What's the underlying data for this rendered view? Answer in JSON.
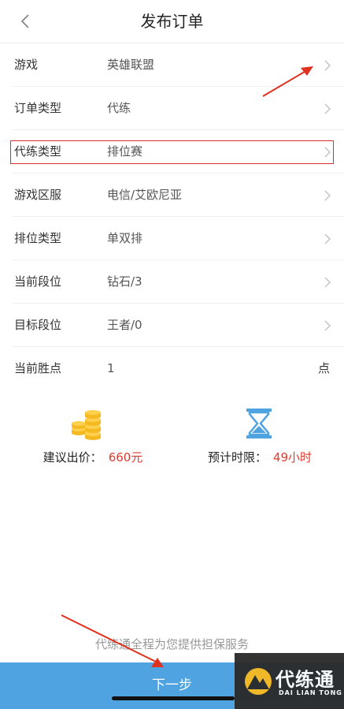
{
  "header": {
    "title": "发布订单"
  },
  "rows": [
    {
      "label": "游戏",
      "value": "英雄联盟"
    },
    {
      "label": "订单类型",
      "value": "代练"
    },
    {
      "label": "代练类型",
      "value": "排位赛"
    },
    {
      "label": "游戏区服",
      "value": "电信/艾欧尼亚"
    },
    {
      "label": "排位类型",
      "value": "单双排"
    },
    {
      "label": "当前段位",
      "value": "钻石/3"
    },
    {
      "label": "目标段位",
      "value": "王者/0"
    }
  ],
  "win_points": {
    "label": "当前胜点",
    "value": "1",
    "unit": "点"
  },
  "price": {
    "label": "建议出价：",
    "value": "660元",
    "icon": "coins-icon"
  },
  "time_limit": {
    "label": "预计时限：",
    "value": "49小时",
    "icon": "hourglass-icon"
  },
  "guarantee_text": "代练通全程为您提供担保服务",
  "next_button": "下一步",
  "watermark": {
    "name": "代练通",
    "pinyin": "DAI LIAN TONG"
  },
  "colors": {
    "accent_blue": "#4fa3e0",
    "highlight_red": "#e03a2f",
    "coin_gold": "#f5b921",
    "hourglass_blue": "#4fa3e0"
  }
}
